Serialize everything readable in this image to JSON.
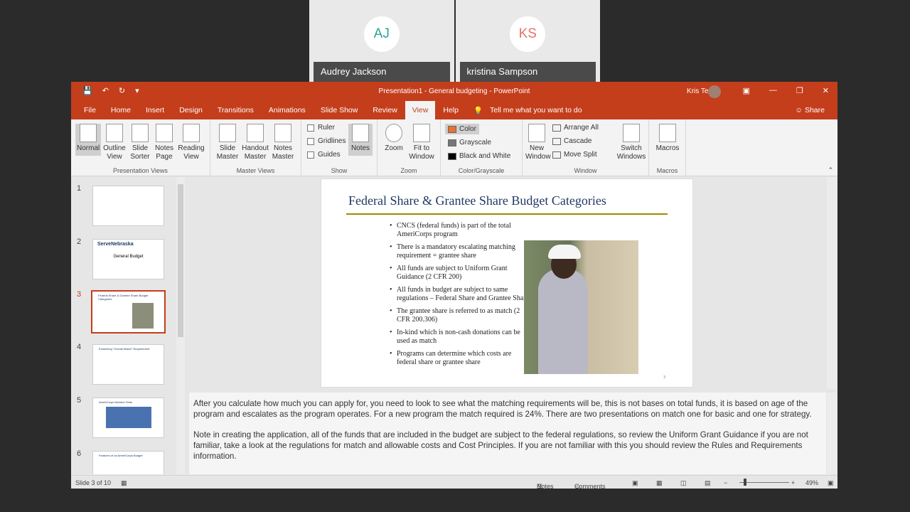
{
  "participants": [
    {
      "initials": "AJ",
      "name": "Audrey Jackson",
      "color": "#2aa593"
    },
    {
      "initials": "KS",
      "name": "kristina Sampson",
      "color": "#e3736b"
    }
  ],
  "window": {
    "title": "Presentation1 - General budgeting  -  PowerPoint",
    "user": "Kris Tecce",
    "accent": "#c43e1c"
  },
  "tabs": [
    "File",
    "Home",
    "Insert",
    "Design",
    "Transitions",
    "Animations",
    "Slide Show",
    "Review",
    "View",
    "Help"
  ],
  "active_tab": "View",
  "tell_me": "Tell me what you want to do",
  "share": "Share",
  "ribbon": {
    "presentation_views": {
      "label": "Presentation Views",
      "buttons": [
        "Normal",
        "Outline View",
        "Slide Sorter",
        "Notes Page",
        "Reading View"
      ]
    },
    "master_views": {
      "label": "Master Views",
      "buttons": [
        "Slide Master",
        "Handout Master",
        "Notes Master"
      ]
    },
    "show": {
      "label": "Show",
      "checks": [
        "Ruler",
        "Gridlines",
        "Guides"
      ],
      "notes": "Notes"
    },
    "zoom": {
      "label": "Zoom",
      "buttons": [
        "Zoom",
        "Fit to Window"
      ]
    },
    "color": {
      "label": "Color/Grayscale",
      "items": [
        "Color",
        "Grayscale",
        "Black and White"
      ]
    },
    "window": {
      "label": "Window",
      "new_window": "New Window",
      "items": [
        "Arrange All",
        "Cascade",
        "Move Split"
      ],
      "switch": "Switch Windows"
    },
    "macros": {
      "label": "Macros",
      "button": "Macros"
    }
  },
  "thumbs": {
    "numbers": [
      "1",
      "2",
      "3",
      "4",
      "5",
      "6"
    ],
    "slide2_brand": "ServeNebraska",
    "slide2_title": "General Budget",
    "slide3_title": "Federal Share & Grantee Share Budget Categories",
    "slide4_title": "Examining \"Overall Match\" Requirement",
    "slide5_title": "AmeriCorps Member Slots",
    "slide6_title": "Features of an AmeriCorps Budget"
  },
  "slide": {
    "title": "Federal Share & Grantee Share Budget Categories",
    "bullets": [
      "CNCS (federal funds) is part of the total AmeriCorps program",
      "There is a mandatory escalating matching requirement = grantee share",
      "All funds are subject to Uniform Grant Guidance (2 CFR 200)",
      "All funds in budget are subject to same regulations – Federal Share and Grantee Share",
      "The grantee share is referred to as match (2 CFR 200.306)",
      "In-kind which is non-cash donations can be used as match",
      "Programs can determine which costs are federal share or grantee share"
    ],
    "page": "3"
  },
  "notes": [
    "After you calculate how much you can apply for, you need to look to see what the matching requirements will be, this is not bases on total funds, it is based on age of the program and escalates as the program operates. For a new program the match required is 24%. There are two presentations on match one for basic and one for strategy.",
    " Note in creating the application, all of the funds that are included in the budget are subject to the federal regulations, so review the Uniform Grant Guidance if you are not familiar,  take a look at the regulations for match and allowable costs and Cost Principles. If you are not familiar with this you should review the Rules and Requirements information."
  ],
  "status": {
    "slide": "Slide 3 of 10",
    "notes": "Notes",
    "comments": "Comments",
    "zoom": "49%"
  }
}
